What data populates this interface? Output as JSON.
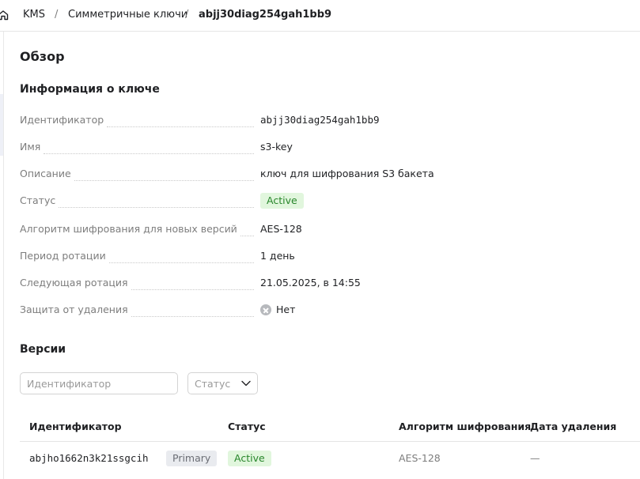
{
  "breadcrumb": {
    "home_icon": "home-icon",
    "items": [
      "KMS",
      "Симметричные ключи",
      "abjj30diag254gah1bb9"
    ],
    "separator": "/"
  },
  "page_title": "Обзор",
  "key_info": {
    "heading": "Информация о ключе",
    "properties": [
      {
        "label": "Идентификатор",
        "value": "abjj30diag254gah1bb9"
      },
      {
        "label": "Имя",
        "value": "s3-key"
      },
      {
        "label": "Описание",
        "value": "ключ для шифрования S3 бакета"
      },
      {
        "label": "Статус",
        "value": "Active"
      },
      {
        "label": "Алгоритм шифрования для новых версий",
        "value": "AES-128"
      },
      {
        "label": "Период ротации",
        "value": "1 день"
      },
      {
        "label": "Следующая ротация",
        "value": "21.05.2025, в 14:55"
      },
      {
        "label": "Защита от удаления",
        "value": "Нет",
        "icon": "x-circle-icon"
      }
    ]
  },
  "versions": {
    "heading": "Версии",
    "filter_placeholder": "Идентификатор",
    "status_select_placeholder": "Статус",
    "columns": [
      "Идентификатор",
      "Статус",
      "Алгоритм шифрования",
      "Дата удаления"
    ],
    "rows": [
      {
        "id": "abjho1662n3k21ssgcih",
        "tag": "Primary",
        "status": "Active",
        "algorithm": "AES-128",
        "deletion_date": "—"
      }
    ]
  },
  "colors": {
    "active_badge_bg": "#e1f6dd",
    "active_badge_text": "#28862b",
    "primary_badge_bg": "#e9ebef"
  }
}
